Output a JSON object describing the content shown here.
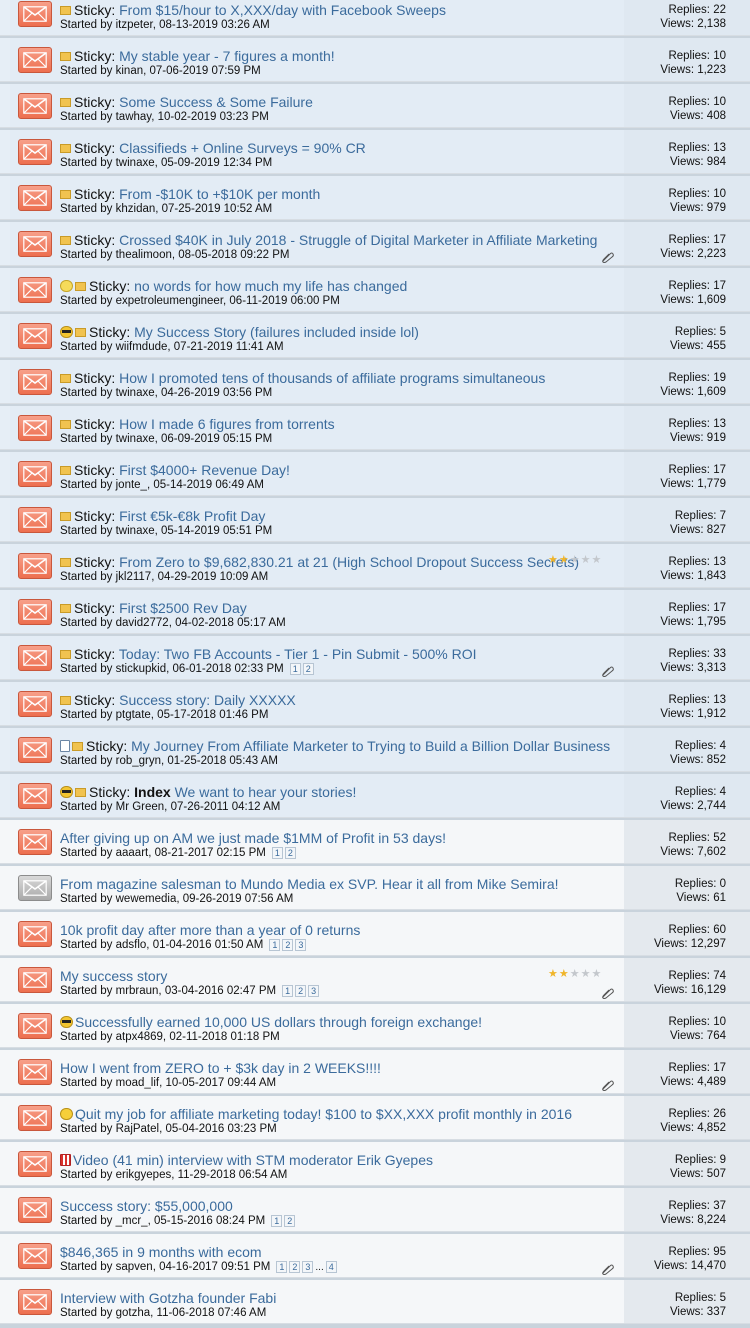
{
  "labels": {
    "replies": "Replies:",
    "views": "Views:",
    "started_by": "Started by",
    "sticky": "Sticky:"
  },
  "threads": [
    {
      "sticky": true,
      "prefix_icon": "",
      "title": "From $15/hour to X,XXX/day with Facebook Sweeps",
      "bold_prefix": "",
      "meta": "Started by itzpeter, 08-13-2019 03:26 AM",
      "pages": [],
      "rating": 0,
      "attach": false,
      "replies": "Replies: 22",
      "views": "Views: 2,138",
      "env": "orange"
    },
    {
      "sticky": true,
      "prefix_icon": "",
      "title": "My stable year - 7 figures a month!",
      "bold_prefix": "",
      "meta": "Started by kinan, 07-06-2019 07:59 PM",
      "pages": [],
      "rating": 0,
      "attach": false,
      "replies": "Replies: 10",
      "views": "Views: 1,223",
      "env": "orange"
    },
    {
      "sticky": true,
      "prefix_icon": "",
      "title": "Some Success & Some Failure",
      "bold_prefix": "",
      "meta": "Started by tawhay, 10-02-2019 03:23 PM",
      "pages": [],
      "rating": 0,
      "attach": false,
      "replies": "Replies: 10",
      "views": "Views: 408",
      "env": "orange"
    },
    {
      "sticky": true,
      "prefix_icon": "",
      "title": "Classifieds + Online Surveys = 90% CR",
      "bold_prefix": "",
      "meta": "Started by twinaxe, 05-09-2019 12:34 PM",
      "pages": [],
      "rating": 0,
      "attach": false,
      "replies": "Replies: 13",
      "views": "Views: 984",
      "env": "orange"
    },
    {
      "sticky": true,
      "prefix_icon": "",
      "title": "From -$10K to +$10K per month",
      "bold_prefix": "",
      "meta": "Started by khzidan, 07-25-2019 10:52 AM",
      "pages": [],
      "rating": 0,
      "attach": false,
      "replies": "Replies: 10",
      "views": "Views: 979",
      "env": "orange"
    },
    {
      "sticky": true,
      "prefix_icon": "",
      "title": "Crossed $40K in July 2018 - Struggle of Digital Marketer in Affiliate Marketing",
      "bold_prefix": "",
      "meta": "Started by thealimoon, 08-05-2018 09:22 PM",
      "pages": [],
      "rating": 0,
      "attach": true,
      "replies": "Replies: 17",
      "views": "Views: 2,223",
      "env": "orange"
    },
    {
      "sticky": true,
      "prefix_icon": "bulb",
      "title": "no words for how much my life has changed",
      "bold_prefix": "",
      "meta": "Started by expetroleumengineer, 06-11-2019 06:00 PM",
      "pages": [],
      "rating": 0,
      "attach": false,
      "replies": "Replies: 17",
      "views": "Views: 1,609",
      "env": "orange"
    },
    {
      "sticky": true,
      "prefix_icon": "cool",
      "title": "My Success Story (failures included inside lol)",
      "bold_prefix": "",
      "meta": "Started by wiifmdude, 07-21-2019 11:41 AM",
      "pages": [],
      "rating": 0,
      "attach": false,
      "replies": "Replies: 5",
      "views": "Views: 455",
      "env": "orange"
    },
    {
      "sticky": true,
      "prefix_icon": "",
      "title": "How I promoted tens of thousands of affiliate programs simultaneous",
      "bold_prefix": "",
      "meta": "Started by twinaxe, 04-26-2019 03:56 PM",
      "pages": [],
      "rating": 0,
      "attach": false,
      "replies": "Replies: 19",
      "views": "Views: 1,609",
      "env": "orange"
    },
    {
      "sticky": true,
      "prefix_icon": "",
      "title": "How I made 6 figures from torrents",
      "bold_prefix": "",
      "meta": "Started by twinaxe, 06-09-2019 05:15 PM",
      "pages": [],
      "rating": 0,
      "attach": false,
      "replies": "Replies: 13",
      "views": "Views: 919",
      "env": "orange"
    },
    {
      "sticky": true,
      "prefix_icon": "",
      "title": "First $4000+ Revenue Day!",
      "bold_prefix": "",
      "meta": "Started by jonte_, 05-14-2019 06:49 AM",
      "pages": [],
      "rating": 0,
      "attach": false,
      "replies": "Replies: 17",
      "views": "Views: 1,779",
      "env": "orange"
    },
    {
      "sticky": true,
      "prefix_icon": "",
      "title": "First €5k-€8k Profit Day",
      "bold_prefix": "",
      "meta": "Started by twinaxe, 05-14-2019 05:51 PM",
      "pages": [],
      "rating": 0,
      "attach": false,
      "replies": "Replies: 7",
      "views": "Views: 827",
      "env": "orange"
    },
    {
      "sticky": true,
      "prefix_icon": "",
      "title": "From Zero to $9,682,830.21 at 21 (High School Dropout Success Secrets)",
      "bold_prefix": "",
      "meta": "Started by jkl2117, 04-29-2019 10:09 AM",
      "pages": [],
      "rating": 2,
      "attach": false,
      "replies": "Replies: 13",
      "views": "Views: 1,843",
      "env": "orange"
    },
    {
      "sticky": true,
      "prefix_icon": "",
      "title": "First $2500 Rev Day",
      "bold_prefix": "",
      "meta": "Started by david2772, 04-02-2018 05:17 AM",
      "pages": [],
      "rating": 0,
      "attach": false,
      "replies": "Replies: 17",
      "views": "Views: 1,795",
      "env": "orange"
    },
    {
      "sticky": true,
      "prefix_icon": "",
      "title": "Today: Two FB Accounts - Tier 1 - Pin Submit - 500% ROI",
      "bold_prefix": "",
      "meta": "Started by stickupkid, 06-01-2018 02:33 PM",
      "pages": [
        "1",
        "2"
      ],
      "rating": 0,
      "attach": true,
      "replies": "Replies: 33",
      "views": "Views: 3,313",
      "env": "orange"
    },
    {
      "sticky": true,
      "prefix_icon": "",
      "title": "Success story: Daily XXXXX",
      "bold_prefix": "",
      "meta": "Started by ptgtate, 05-17-2018 01:46 PM",
      "pages": [],
      "rating": 0,
      "attach": false,
      "replies": "Replies: 13",
      "views": "Views: 1,912",
      "env": "orange"
    },
    {
      "sticky": true,
      "prefix_icon": "doc",
      "title": "My Journey From Affiliate Marketer to Trying to Build a Billion Dollar Business",
      "bold_prefix": "",
      "meta": "Started by rob_gryn, 01-25-2018 05:43 AM",
      "pages": [],
      "rating": 0,
      "attach": false,
      "replies": "Replies: 4",
      "views": "Views: 852",
      "env": "orange"
    },
    {
      "sticky": true,
      "prefix_icon": "cool",
      "title": "We want to hear your stories!",
      "bold_prefix": "Index",
      "meta": "Started by Mr Green, 07-26-2011 04:12 AM",
      "pages": [],
      "rating": 0,
      "attach": false,
      "replies": "Replies: 4",
      "views": "Views: 2,744",
      "env": "orange"
    },
    {
      "sticky": false,
      "prefix_icon": "",
      "title": "After giving up on AM we just made $1MM of Profit in 53 days!",
      "bold_prefix": "",
      "meta": "Started by aaaart, 08-21-2017 02:15 PM",
      "pages": [
        "1",
        "2"
      ],
      "rating": 0,
      "attach": false,
      "replies": "Replies: 52",
      "views": "Views: 7,602",
      "env": "orange"
    },
    {
      "sticky": false,
      "prefix_icon": "",
      "title": "From magazine salesman to Mundo Media ex SVP. Hear it all from Mike Semira!",
      "bold_prefix": "",
      "meta": "Started by wewemedia, 09-26-2019 07:56 AM",
      "pages": [],
      "rating": 0,
      "attach": false,
      "replies": "Replies: 0",
      "views": "Views: 61",
      "env": "gray"
    },
    {
      "sticky": false,
      "prefix_icon": "",
      "title": "10k profit day after more than a year of 0 returns",
      "bold_prefix": "",
      "meta": "Started by adsflo, 01-04-2016 01:50 AM",
      "pages": [
        "1",
        "2",
        "3"
      ],
      "rating": 0,
      "attach": false,
      "replies": "Replies: 60",
      "views": "Views: 12,297",
      "env": "orange"
    },
    {
      "sticky": false,
      "prefix_icon": "",
      "title": "My success story",
      "bold_prefix": "",
      "meta": "Started by mrbraun, 03-04-2016 02:47 PM",
      "pages": [
        "1",
        "2",
        "3"
      ],
      "rating": 2,
      "attach": true,
      "replies": "Replies: 74",
      "views": "Views: 16,129",
      "env": "orange"
    },
    {
      "sticky": false,
      "prefix_icon": "cool",
      "title": "Successfully earned 10,000 US dollars through foreign exchange!",
      "bold_prefix": "",
      "meta": "Started by atpx4869, 02-11-2018 01:18 PM",
      "pages": [],
      "rating": 0,
      "attach": false,
      "replies": "Replies: 10",
      "views": "Views: 764",
      "env": "orange"
    },
    {
      "sticky": false,
      "prefix_icon": "",
      "title": "How I went from ZERO to + $3k day in 2 WEEKS!!!!",
      "bold_prefix": "",
      "meta": "Started by moad_lif, 10-05-2017 09:44 AM",
      "pages": [],
      "rating": 0,
      "attach": true,
      "replies": "Replies: 17",
      "views": "Views: 4,489",
      "env": "orange"
    },
    {
      "sticky": false,
      "prefix_icon": "smile",
      "title": "Quit my job for affiliate marketing today! $100 to $XX,XXX profit monthly in 2016",
      "bold_prefix": "",
      "meta": "Started by RajPatel, 05-04-2016 03:23 PM",
      "pages": [],
      "rating": 0,
      "attach": false,
      "replies": "Replies: 26",
      "views": "Views: 4,852",
      "env": "orange"
    },
    {
      "sticky": false,
      "prefix_icon": "popcorn",
      "title": "Video (41 min) interview with STM moderator Erik Gyepes",
      "bold_prefix": "",
      "meta": "Started by erikgyepes, 11-29-2018 06:54 AM",
      "pages": [],
      "rating": 0,
      "attach": false,
      "replies": "Replies: 9",
      "views": "Views: 507",
      "env": "orange"
    },
    {
      "sticky": false,
      "prefix_icon": "",
      "title": "Success story: $55,000,000",
      "bold_prefix": "",
      "meta": "Started by _mcr_, 05-15-2016 08:24 PM",
      "pages": [
        "1",
        "2"
      ],
      "rating": 0,
      "attach": false,
      "replies": "Replies: 37",
      "views": "Views: 8,224",
      "env": "orange"
    },
    {
      "sticky": false,
      "prefix_icon": "",
      "title": "$846,365 in 9 months with ecom",
      "bold_prefix": "",
      "meta": "Started by sapven, 04-16-2017 09:51 PM",
      "pages": [
        "1",
        "2",
        "3",
        "...",
        "4"
      ],
      "rating": 0,
      "attach": true,
      "replies": "Replies: 95",
      "views": "Views: 14,470",
      "env": "orange"
    },
    {
      "sticky": false,
      "prefix_icon": "",
      "title": "Interview with Gotzha founder Fabi",
      "bold_prefix": "",
      "meta": "Started by gotzha, 11-06-2018 07:46 AM",
      "pages": [],
      "rating": 0,
      "attach": false,
      "replies": "Replies: 5",
      "views": "Views: 337",
      "env": "orange"
    }
  ],
  "icons": {
    "status": "envelope-icon",
    "sticky": "folder-icon",
    "attachment": "paperclip-icon",
    "rating": "star-icon"
  },
  "colors": {
    "title_link": "#3b6b9c",
    "sticky_bg": "#e3ecf5",
    "envelope_new": "#ed6f4f",
    "envelope_old": "#a9a9a9",
    "star": "#f0b52a"
  }
}
